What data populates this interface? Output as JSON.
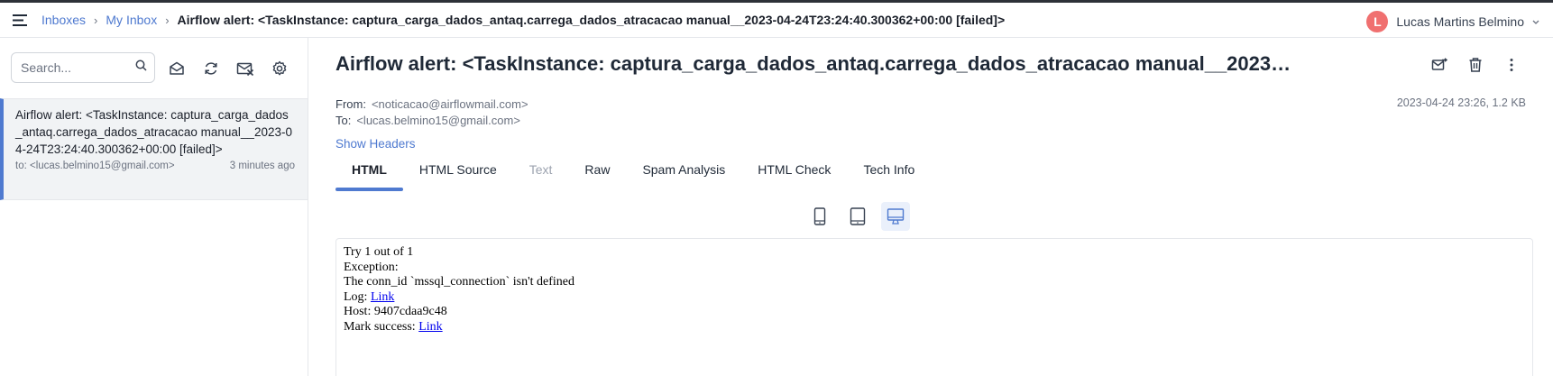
{
  "breadcrumb": {
    "inboxes": "Inboxes",
    "my_inbox": "My Inbox",
    "current": "Airflow alert: <TaskInstance: captura_carga_dados_antaq.carrega_dados_atracacao manual__2023-04-24T23:24:40.300362+00:00 [failed]>"
  },
  "user": {
    "initial": "L",
    "name": "Lucas Martins Belmino"
  },
  "search": {
    "placeholder": "Search..."
  },
  "message_list": [
    {
      "subject": "Airflow alert: <TaskInstance: captura_carga_dados_antaq.carrega_dados_atracacao manual__2023-04-24T23:24:40.300362+00:00 [failed]>",
      "to": "to: <lucas.belmino15@gmail.com>",
      "time": "3 minutes ago"
    }
  ],
  "message": {
    "subject": "Airflow alert: <TaskInstance: captura_carga_dados_antaq.carrega_dados_atracacao manual__2023-04-24T23:24:40.300362+00:00 [failed]>",
    "from_label": "From:",
    "from": "<noticacao@airflowmail.com>",
    "to_label": "To:",
    "to": "<lucas.belmino15@gmail.com>",
    "date_size": "2023-04-24 23:26, 1.2 KB",
    "show_headers": "Show Headers"
  },
  "tabs": [
    {
      "label": "HTML",
      "state": "active"
    },
    {
      "label": "HTML Source",
      "state": "normal"
    },
    {
      "label": "Text",
      "state": "disabled"
    },
    {
      "label": "Raw",
      "state": "normal"
    },
    {
      "label": "Spam Analysis",
      "state": "normal"
    },
    {
      "label": "HTML Check",
      "state": "normal"
    },
    {
      "label": "Tech Info",
      "state": "normal"
    }
  ],
  "body": {
    "line1": "Try 1 out of 1",
    "line2": "Exception:",
    "line3": "The conn_id `mssql_connection` isn't defined",
    "log_label": "Log: ",
    "log_link": "Link",
    "host": "Host: 9407cdaa9c48",
    "mark_label": "Mark success: ",
    "mark_link": "Link"
  },
  "colors": {
    "accent": "#4f7ad0",
    "avatar": "#f07070",
    "selected_bg": "#f1f3f5"
  }
}
